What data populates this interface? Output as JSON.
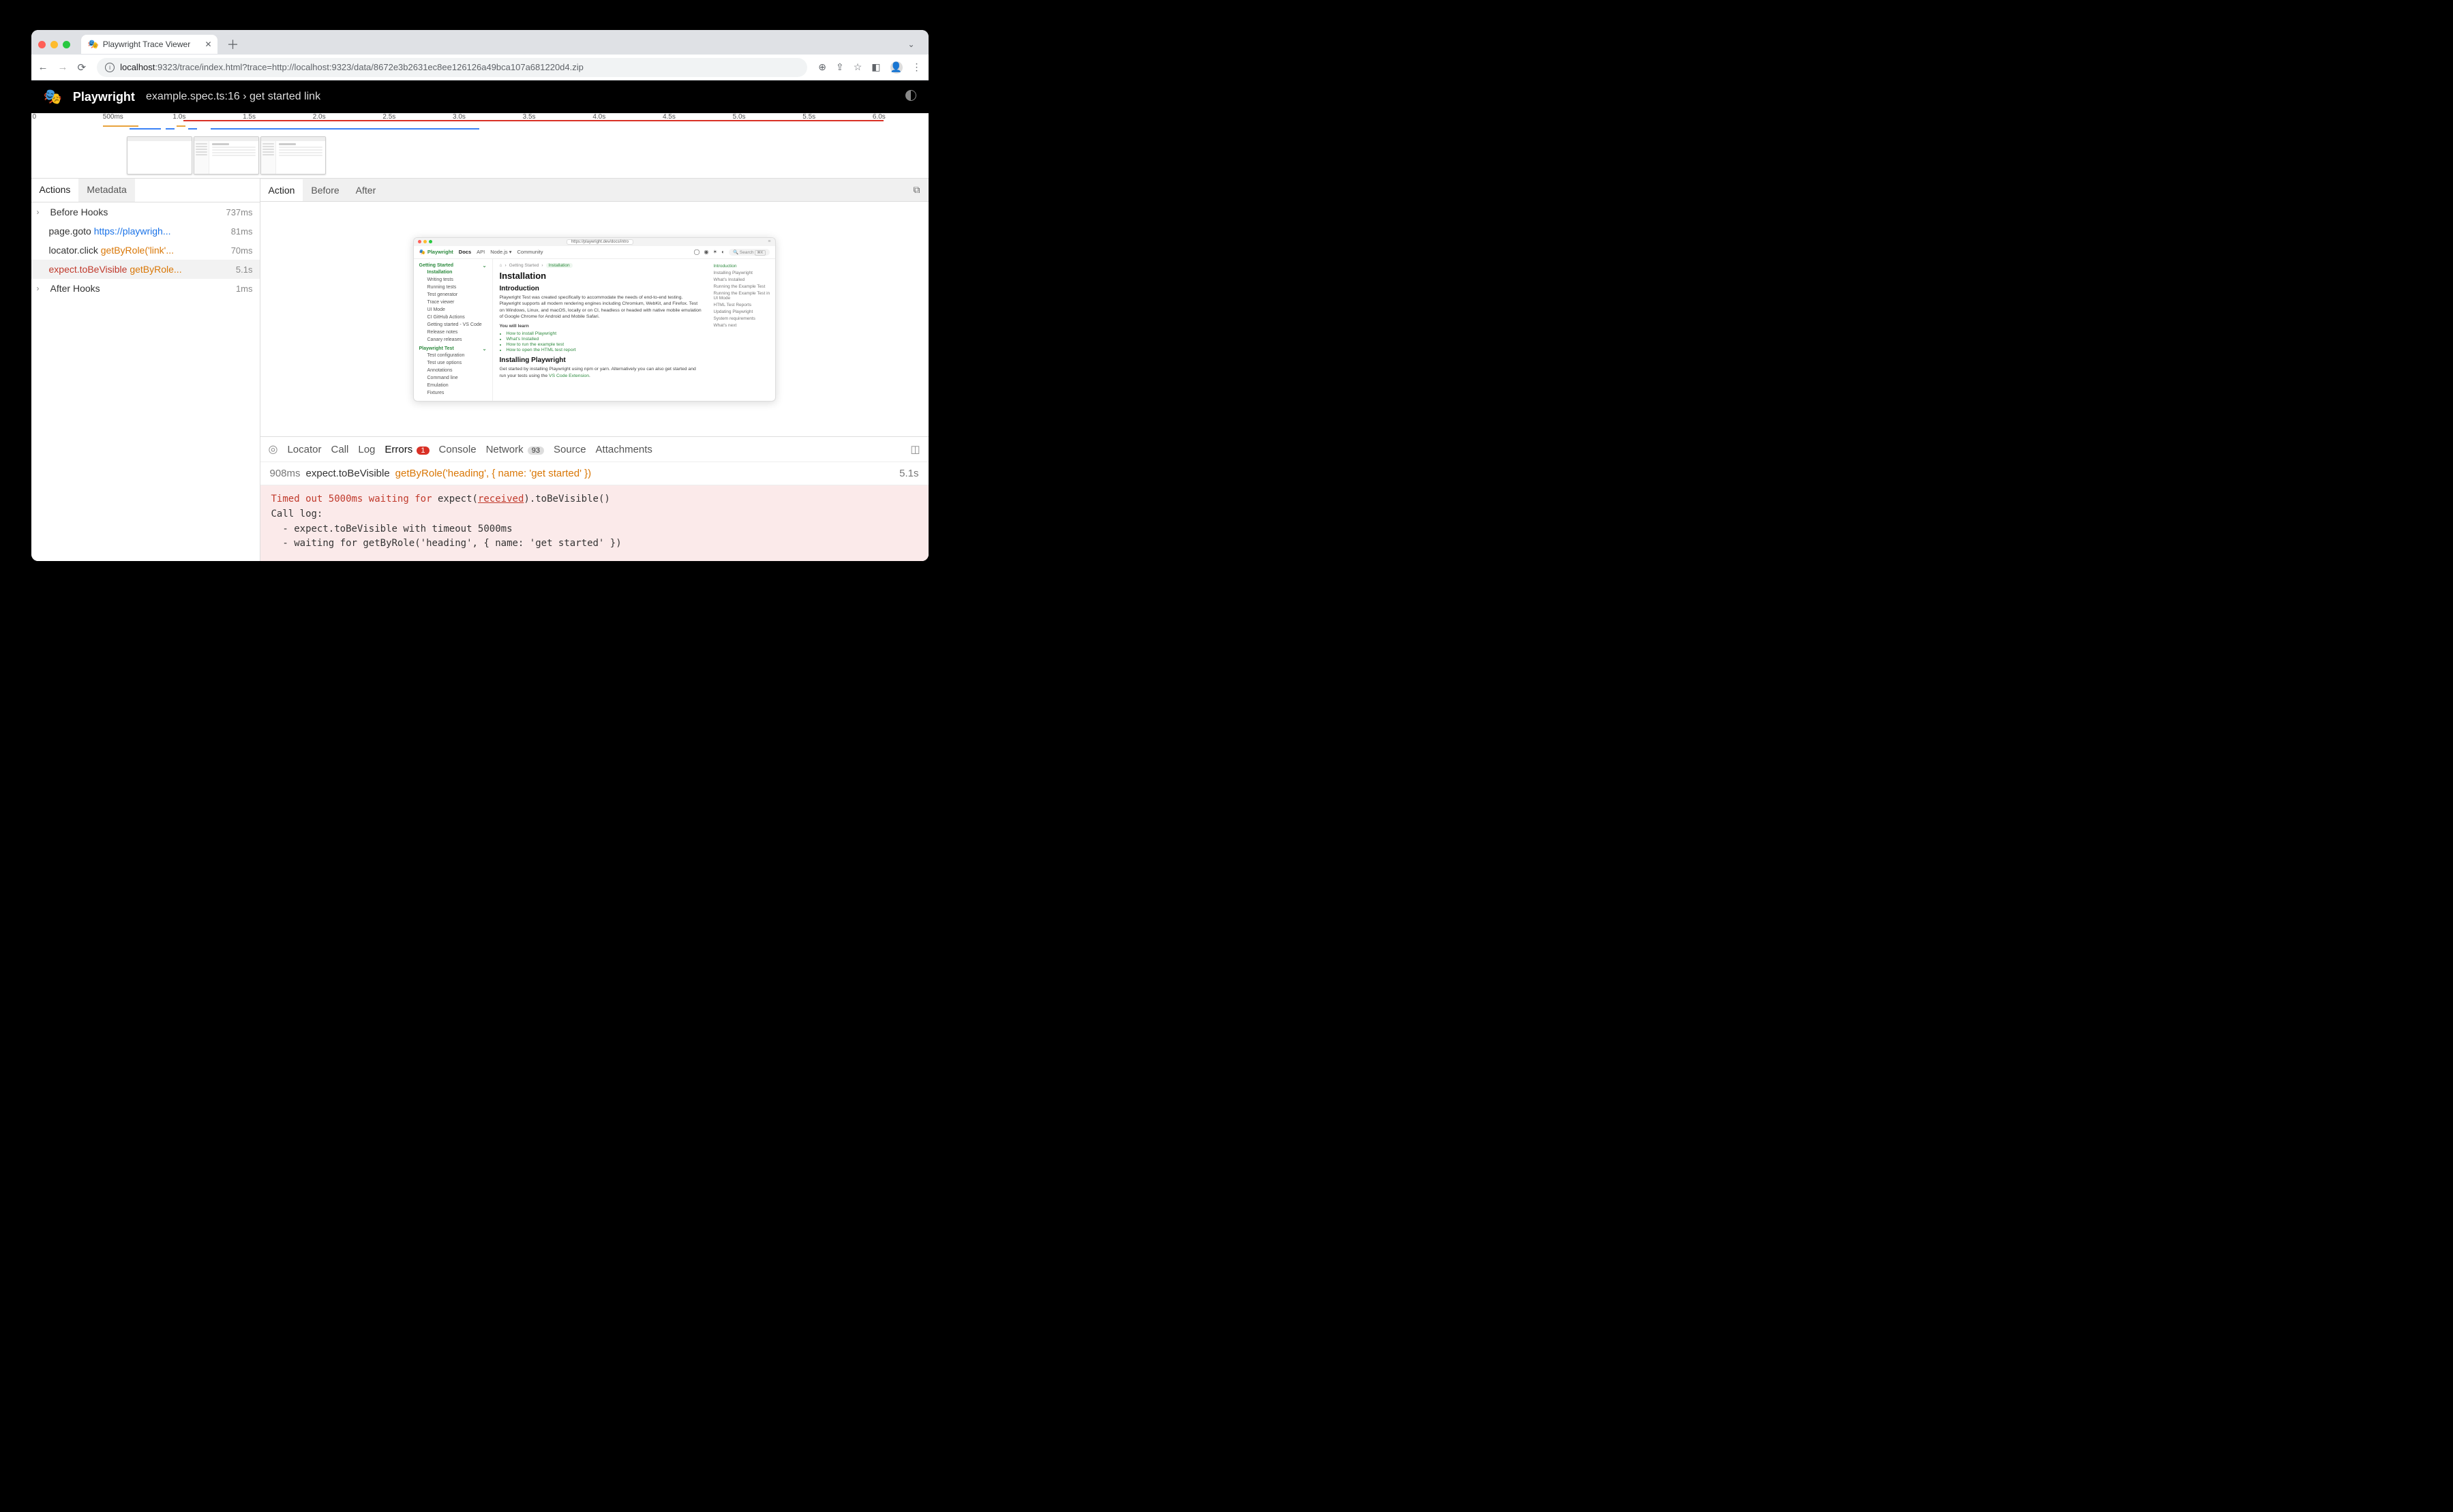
{
  "browser": {
    "tabTitle": "Playwright Trace Viewer",
    "url_host": "localhost",
    "url_rest": ":9323/trace/index.html?trace=http://localhost:9323/data/8672e3b2631ec8ee126126a49bca107a681220d4.zip"
  },
  "header": {
    "title": "Playwright",
    "subtitle": "example.spec.ts:16 › get started link"
  },
  "timeline": {
    "ticks": [
      "0",
      "500ms",
      "1.0s",
      "1.5s",
      "2.0s",
      "2.5s",
      "3.0s",
      "3.5s",
      "4.0s",
      "4.5s",
      "5.0s",
      "5.5s",
      "6.0s"
    ]
  },
  "leftTabs": {
    "a": "Actions",
    "b": "Metadata"
  },
  "actions": {
    "beforeHooks": {
      "label": "Before Hooks",
      "dur": "737ms"
    },
    "goto": {
      "api": "page.goto",
      "arg": "https://playwrigh...",
      "dur": "81ms"
    },
    "click": {
      "api": "locator.click",
      "arg": "getByRole('link'...",
      "dur": "70ms"
    },
    "expect": {
      "api": "expect.toBeVisible",
      "arg": "getByRole...",
      "dur": "5.1s"
    },
    "afterHooks": {
      "label": "After Hooks",
      "dur": "1ms"
    }
  },
  "snapshotTabs": {
    "action": "Action",
    "before": "Before",
    "after": "After"
  },
  "miniPage": {
    "url": "https://playwright.dev/docs/intro",
    "brand": "Playwright",
    "nav": {
      "docs": "Docs",
      "api": "API",
      "node": "Node.js",
      "community": "Community",
      "search": "Search"
    },
    "side": {
      "heading": "Getting Started",
      "items": [
        "Installation",
        "Writing tests",
        "Running tests",
        "Test generator",
        "Trace viewer",
        "UI Mode",
        "CI GitHub Actions",
        "Getting started - VS Code",
        "Release notes",
        "Canary releases"
      ],
      "heading2": "Playwright Test",
      "items2": [
        "Test configuration",
        "Test use options",
        "Annotations",
        "Command line",
        "Emulation",
        "Fixtures"
      ]
    },
    "crumbs": {
      "home": "⌂",
      "a": "Getting Started",
      "b": "Installation"
    },
    "h1": "Installation",
    "h2a": "Introduction",
    "p1": "Playwright Test was created specifically to accommodate the needs of end-to-end testing. Playwright supports all modern rendering engines including Chromium, WebKit, and Firefox. Test on Windows, Linux, and macOS, locally or on CI, headless or headed with native mobile emulation of Google Chrome for Android and Mobile Safari.",
    "youwill": "You will learn",
    "bullets": [
      "How to install Playwright",
      "What's Installed",
      "How to run the example test",
      "How to open the HTML test report"
    ],
    "h2b": "Installing Playwright",
    "p2a": "Get started by installing Playwright using npm or yarn. Alternatively you can also get started and run your tests using the ",
    "p2link": "VS Code Extension",
    "p2b": ".",
    "toc": [
      "Introduction",
      "Installing Playwright",
      "What's Installed",
      "Running the Example Test",
      "Running the Example Test in UI Mode",
      "HTML Test Reports",
      "Updating Playwright",
      "System requirements",
      "What's next"
    ]
  },
  "bottomTabs": {
    "locator": "Locator",
    "call": "Call",
    "log": "Log",
    "errors": "Errors",
    "errorsBadge": "1",
    "console": "Console",
    "network": "Network",
    "networkBadge": "93",
    "source": "Source",
    "attachments": "Attachments"
  },
  "error": {
    "ms": "908ms",
    "api": "expect.toBeVisible",
    "loc": "getByRole('heading', { name: 'get started' })",
    "dur": "5.1s",
    "line1a": "Timed out 5000ms waiting for ",
    "line1b": "expect(",
    "line1c": "received",
    "line1d": ").toBeVisible()",
    "line2": "Call log:",
    "line3": "  - expect.toBeVisible with timeout 5000ms",
    "line4": "  - waiting for getByRole('heading', { name: 'get started' })"
  }
}
